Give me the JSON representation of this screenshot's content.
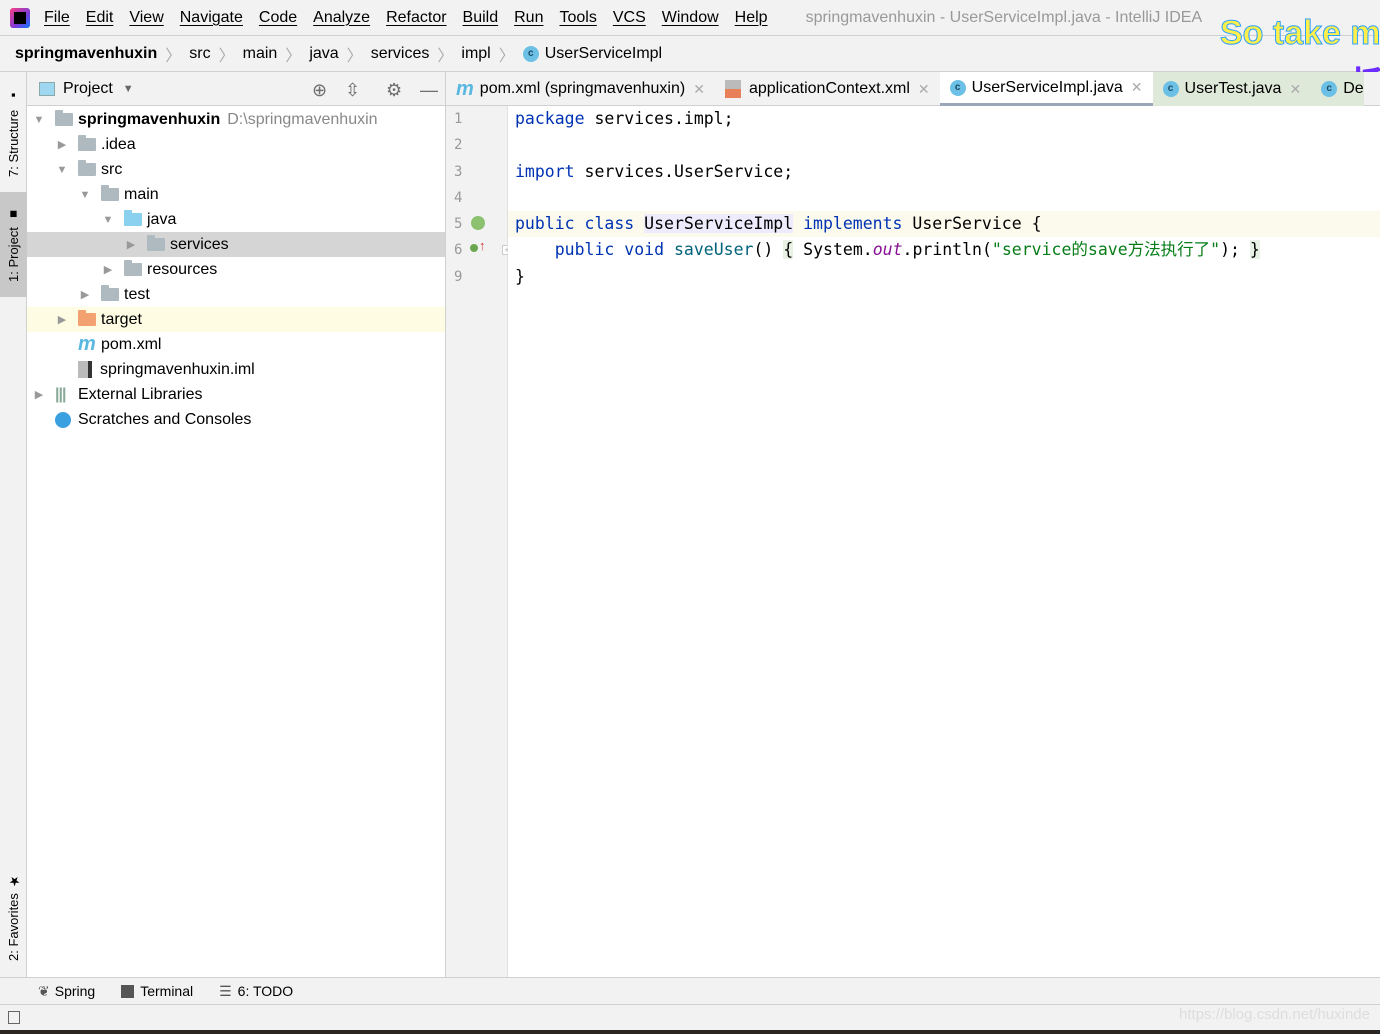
{
  "menu": {
    "items": [
      "File",
      "Edit",
      "View",
      "Navigate",
      "Code",
      "Analyze",
      "Refactor",
      "Build",
      "Run",
      "Tools",
      "VCS",
      "Window",
      "Help"
    ],
    "window_title": "springmavenhuxin - UserServiceImpl.java - IntelliJ IDEA"
  },
  "overlay": {
    "lyric_line1": "So take my",
    "lyric_line2": "抓"
  },
  "breadcrumb": [
    "springmavenhuxin",
    "src",
    "main",
    "java",
    "services",
    "impl",
    "UserServiceImpl"
  ],
  "left_stripe": {
    "structure": "7: Structure",
    "project": "1: Project",
    "favorites": "2: Favorites"
  },
  "project_panel": {
    "title": "Project",
    "tree": [
      {
        "label": "springmavenhuxin",
        "path": "D:\\springmavenhuxin",
        "depth": 0,
        "expanded": true,
        "icon": "module-folder"
      },
      {
        "label": ".idea",
        "depth": 1,
        "expanded": false,
        "icon": "folder"
      },
      {
        "label": "src",
        "depth": 1,
        "expanded": true,
        "icon": "folder"
      },
      {
        "label": "main",
        "depth": 2,
        "expanded": true,
        "icon": "folder"
      },
      {
        "label": "java",
        "depth": 3,
        "expanded": true,
        "icon": "source-folder"
      },
      {
        "label": "services",
        "depth": 4,
        "expanded": false,
        "icon": "package",
        "selected": true
      },
      {
        "label": "resources",
        "depth": 3,
        "expanded": false,
        "icon": "resources-folder"
      },
      {
        "label": "test",
        "depth": 2,
        "expanded": false,
        "icon": "folder"
      },
      {
        "label": "target",
        "depth": 1,
        "expanded": false,
        "icon": "excluded-folder",
        "highlighted": true
      },
      {
        "label": "pom.xml",
        "depth": 1,
        "icon": "maven"
      },
      {
        "label": "springmavenhuxin.iml",
        "depth": 1,
        "icon": "iml-file"
      },
      {
        "label": "External Libraries",
        "depth": 0,
        "expanded": false,
        "icon": "libraries"
      },
      {
        "label": "Scratches and Consoles",
        "depth": 0,
        "icon": "scratches"
      }
    ]
  },
  "tabs": [
    {
      "label": "pom.xml (springmavenhuxin)",
      "icon": "maven",
      "active": false
    },
    {
      "label": "applicationContext.xml",
      "icon": "spring-xml",
      "active": false
    },
    {
      "label": "UserServiceImpl.java",
      "icon": "class",
      "active": true
    },
    {
      "label": "UserTest.java",
      "icon": "test-class",
      "active": false
    },
    {
      "label": "De",
      "icon": "test-class",
      "active": false
    }
  ],
  "editor": {
    "line_numbers": [
      "1",
      "2",
      "3",
      "4",
      "5",
      "6",
      "9"
    ],
    "line1": {
      "kw": "package",
      "rest": " services.impl;"
    },
    "line3": {
      "kw": "import",
      "rest": " services.UserService;"
    },
    "line5": {
      "kw1": "public",
      "kw2": "class",
      "name": "UserServiceImpl",
      "kw3": "implements",
      "rest": " UserService {"
    },
    "line6": {
      "kw1": "public",
      "kw2": "void",
      "method": "saveUser",
      "p1": "() ",
      "b1": "{",
      "p2": " System.",
      "fld": "out",
      "p3": ".println(",
      "str": "\"service的save方法执行了\"",
      "p4": "); ",
      "b2": "}"
    },
    "line9": "}"
  },
  "bottom_bar": {
    "spring": "Spring",
    "terminal": "Terminal",
    "todo": "6: TODO"
  },
  "watermark": "https://blog.csdn.net/huxinde",
  "colors": {
    "keyword": "#0033b3",
    "string": "#067d17",
    "field": "#871094",
    "selection": "#d5d5d5",
    "current_line": "#fcfaed"
  }
}
